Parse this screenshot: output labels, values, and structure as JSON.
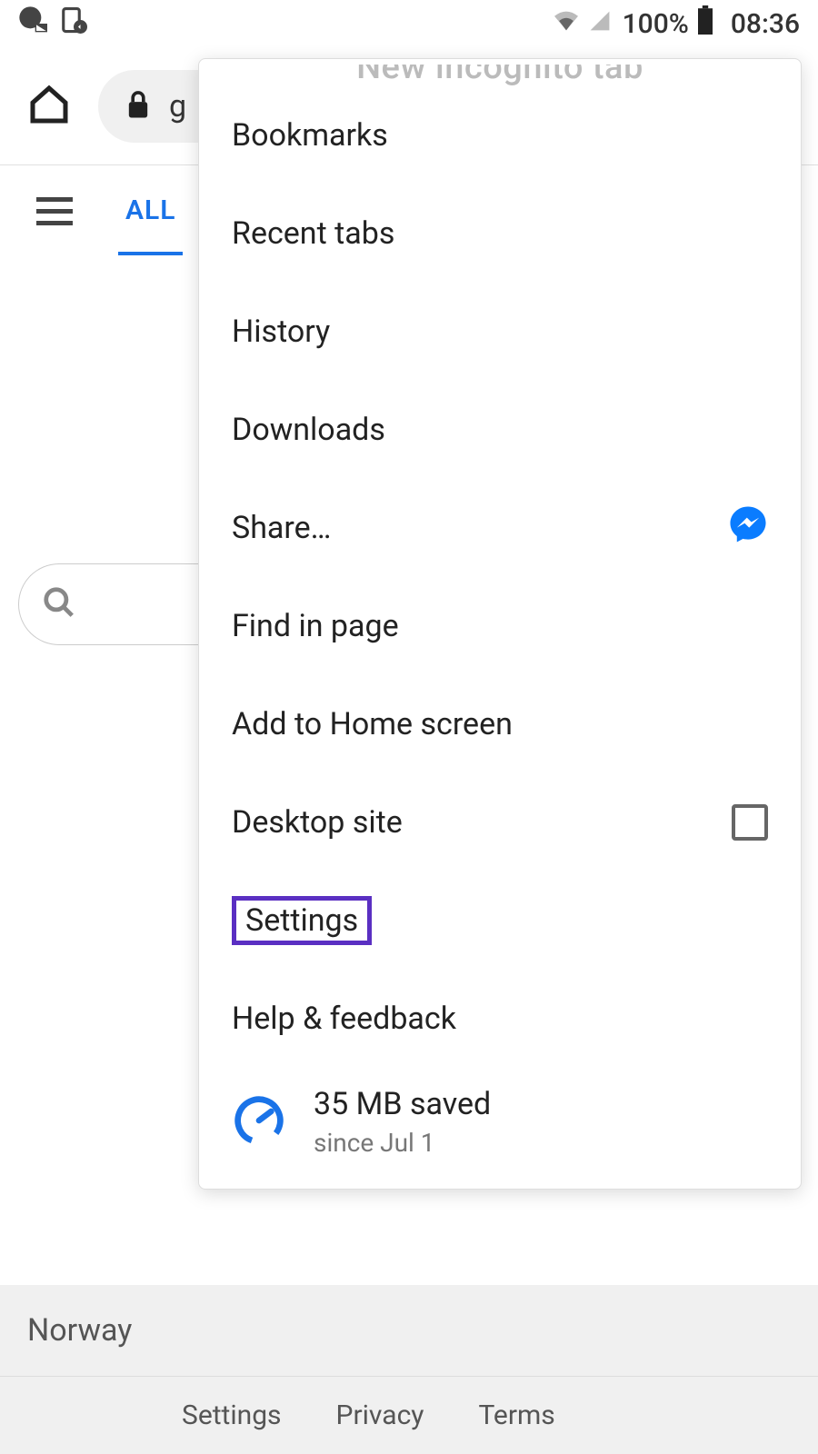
{
  "status": {
    "battery_pct": "100%",
    "time": "08:36"
  },
  "toolbar": {
    "url_fragment": "g"
  },
  "tabs": {
    "all_label": "ALL"
  },
  "menu": {
    "cutoff_label": "New incognito tab",
    "items": {
      "bookmarks": "Bookmarks",
      "recent_tabs": "Recent tabs",
      "history": "History",
      "downloads": "Downloads",
      "share": "Share…",
      "find_in_page": "Find in page",
      "add_to_home": "Add to Home screen",
      "desktop_site": "Desktop site",
      "settings": "Settings",
      "help_feedback": "Help & feedback"
    },
    "data_saver": {
      "line1": "35 MB saved",
      "line2": "since Jul 1"
    }
  },
  "footer": {
    "location": "Norway",
    "links": {
      "settings": "Settings",
      "privacy": "Privacy",
      "terms": "Terms"
    }
  }
}
